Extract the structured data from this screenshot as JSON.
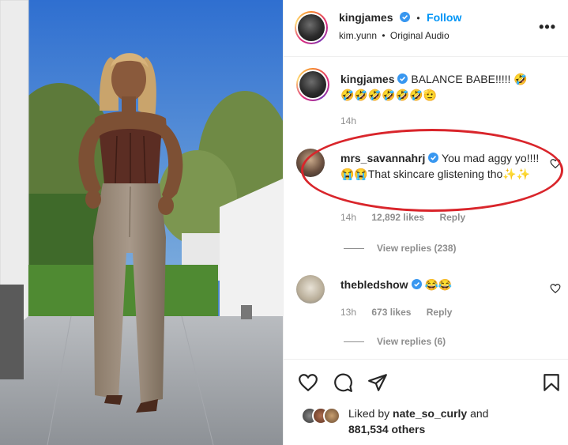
{
  "post": {
    "username": "kingjames",
    "follow_label": "Follow",
    "audio_user": "kim.yunn",
    "audio_sep": "•",
    "audio_label": "Original Audio",
    "more_icon": "more-icon"
  },
  "comments": [
    {
      "username": "kingjames",
      "text": "BALANCE BABE!!!!! 🤣🤣🤣🤣🤣🤣🤣🫡",
      "time": "14h"
    },
    {
      "username": "mrs_savannahrj",
      "text": "You mad aggy yo!!!! 😭😭That skincare glistening tho✨✨",
      "time": "14h",
      "likes": "12,892 likes",
      "reply": "Reply",
      "view_replies": "View replies (238)"
    },
    {
      "username": "thebledshow",
      "text": "😂😂",
      "time": "13h",
      "likes": "673 likes",
      "reply": "Reply",
      "view_replies": "View replies (6)"
    }
  ],
  "likes_summary": {
    "prefix": "Liked by ",
    "user": "nate_so_curly",
    "mid": " and",
    "count": "881,534 others"
  },
  "colors": {
    "link_blue": "#0095f6",
    "verified_blue": "#3897f0",
    "highlight_red": "#d9252b",
    "meta_gray": "#8e8e8e"
  }
}
